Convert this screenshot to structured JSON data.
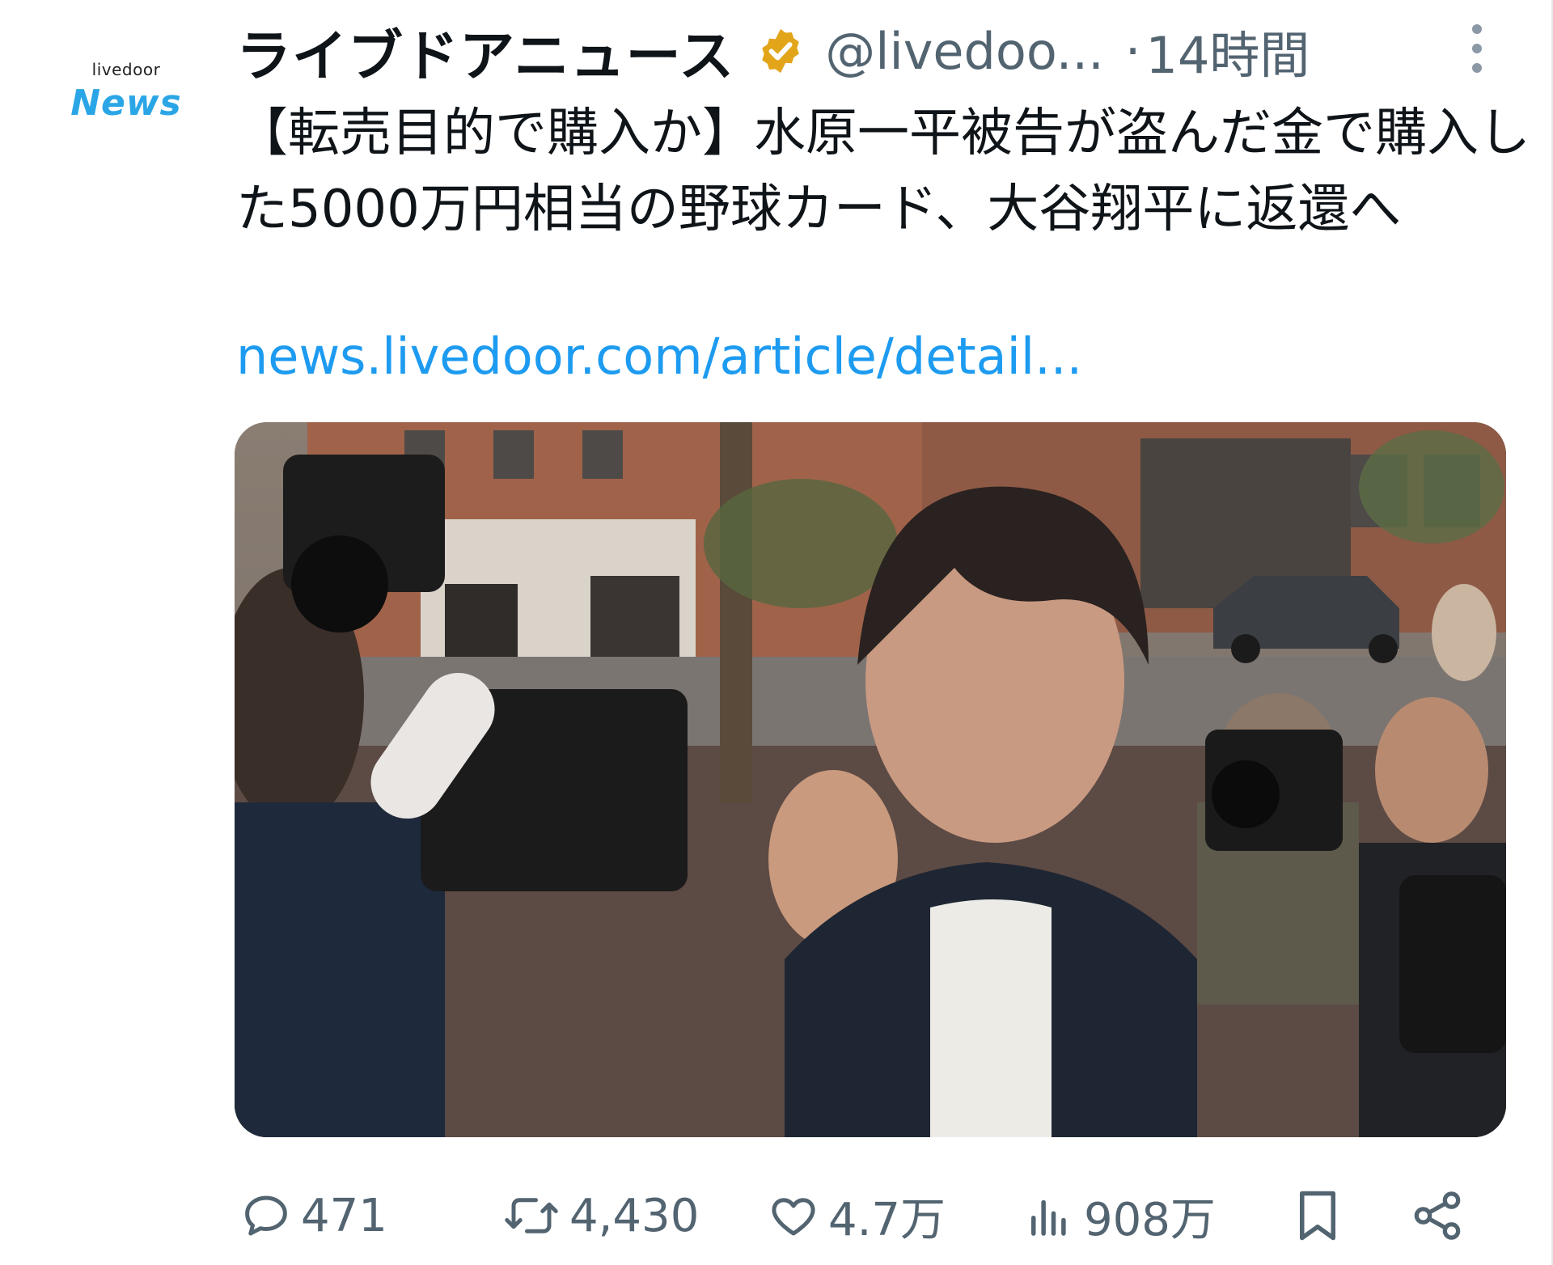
{
  "account": {
    "avatar_top": "livedoor",
    "avatar_bottom": "News",
    "display_name": "ライブドアニュース",
    "handle": "@livedoo...",
    "separator": "·",
    "time": "14時間"
  },
  "post": {
    "text": "【転売目的で購入か】水原一平被告が盗んだ金で購入した5000万円相当の野球カード、大谷翔平に返還へ",
    "link": "news.livedoor.com/article/detail..."
  },
  "actions": {
    "replies": "471",
    "reposts": "4,430",
    "likes": "4.7万",
    "views": "908万"
  },
  "colors": {
    "text": "#0f1419",
    "secondary": "#536471",
    "link": "#1d9bf0",
    "verified_badge": "#e2a51a",
    "avatar_news": "#2aa6e6"
  },
  "icons": [
    "verified-badge-icon",
    "more-icon",
    "reply-icon",
    "repost-icon",
    "like-icon",
    "views-icon",
    "bookmark-icon",
    "share-icon"
  ]
}
